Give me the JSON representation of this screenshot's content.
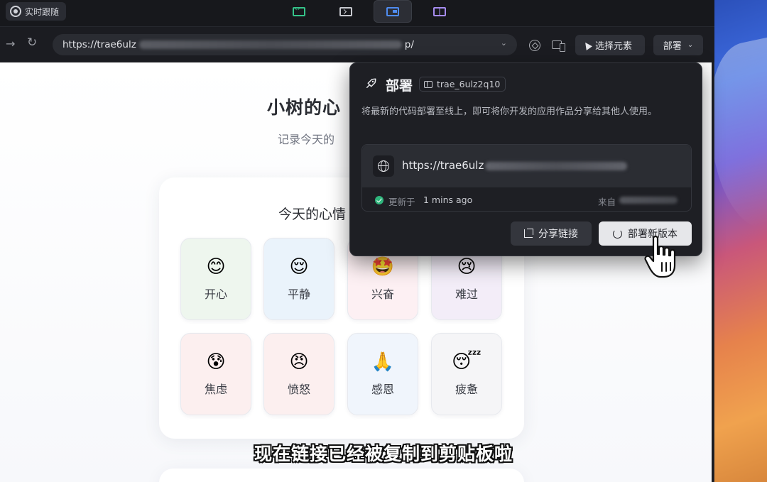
{
  "tabbar": {
    "live_follow_label": "实时跟随",
    "tabs": [
      {
        "name": "code-icon",
        "active": false
      },
      {
        "name": "terminal-icon",
        "active": false
      },
      {
        "name": "web-preview-icon",
        "active": true
      },
      {
        "name": "document-icon",
        "active": false
      }
    ]
  },
  "navbar": {
    "url_prefix": "https://trae6ulz",
    "url_suffix": "p/",
    "select_element_label": "选择元素",
    "deploy_label": "部署"
  },
  "site": {
    "title": "小树的心",
    "subtitle": "记录今天的",
    "mood_heading": "今天的心情",
    "moods": [
      {
        "emoji": "😊",
        "label": "开心",
        "bg": "#eef6ee"
      },
      {
        "emoji": "😌",
        "label": "平静",
        "bg": "#eaf3fb"
      },
      {
        "emoji": "🤩",
        "label": "兴奋",
        "bg": "#fdf0f3"
      },
      {
        "emoji": "😢",
        "label": "难过",
        "bg": "#f3edf8"
      },
      {
        "emoji": "😰",
        "label": "焦虑",
        "bg": "#fcefef"
      },
      {
        "emoji": "😠",
        "label": "愤怒",
        "bg": "#fcefef"
      },
      {
        "emoji": "🙏",
        "label": "感恩",
        "bg": "#f0f5fc"
      },
      {
        "emoji": "😴",
        "label": "疲惫",
        "bg": "#f5f5f7"
      }
    ]
  },
  "popover": {
    "title": "部署",
    "project_name": "trae_6ulz2q10",
    "description": "将最新的代码部署至线上，即可将你开发的应用作品分享给其他人使用。",
    "deploy_url_prefix": "https://trae6ulz",
    "updated_label": "更新于",
    "updated_time": "1 mins ago",
    "from_label": "来自",
    "share_label": "分享链接",
    "redeploy_label": "部署新版本"
  },
  "subtitle": "现在链接已经被复制到剪贴板啦",
  "colors": {
    "accent_green": "#2fb57c",
    "popover_bg": "#1e1f24",
    "primary_button": "#e6e7ea"
  }
}
